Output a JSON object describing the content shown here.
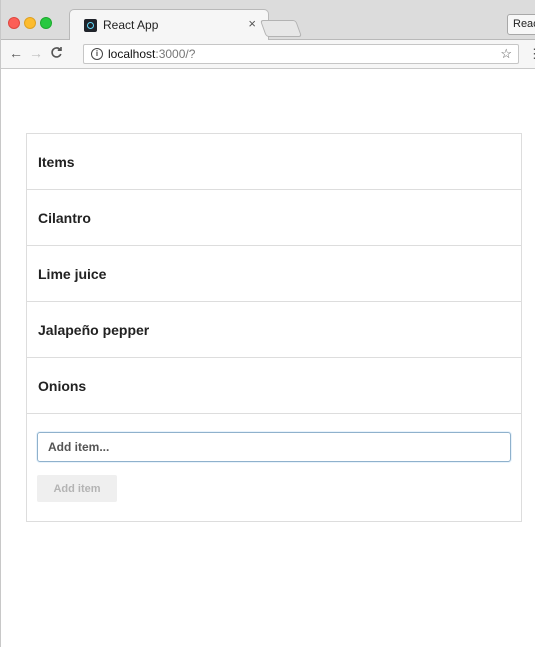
{
  "browser": {
    "tab_title": "React App",
    "tab_close": "×",
    "profile_label": "React",
    "url_host": "localhost",
    "url_rest": ":3000/?",
    "icons": {
      "back": "←",
      "forward": "→",
      "reload": "C",
      "info": "i",
      "star": "☆",
      "menu": "⋮"
    }
  },
  "list": {
    "header": "Items",
    "items": [
      "Cilantro",
      "Lime juice",
      "Jalapeño pepper",
      "Onions"
    ]
  },
  "form": {
    "input_placeholder": "Add item...",
    "input_value": "",
    "button_label": "Add item"
  },
  "colors": {
    "input_border": "#8fb1cc",
    "button_bg": "#efefef",
    "button_text": "#b4b4b4",
    "divider": "#dddddd"
  }
}
